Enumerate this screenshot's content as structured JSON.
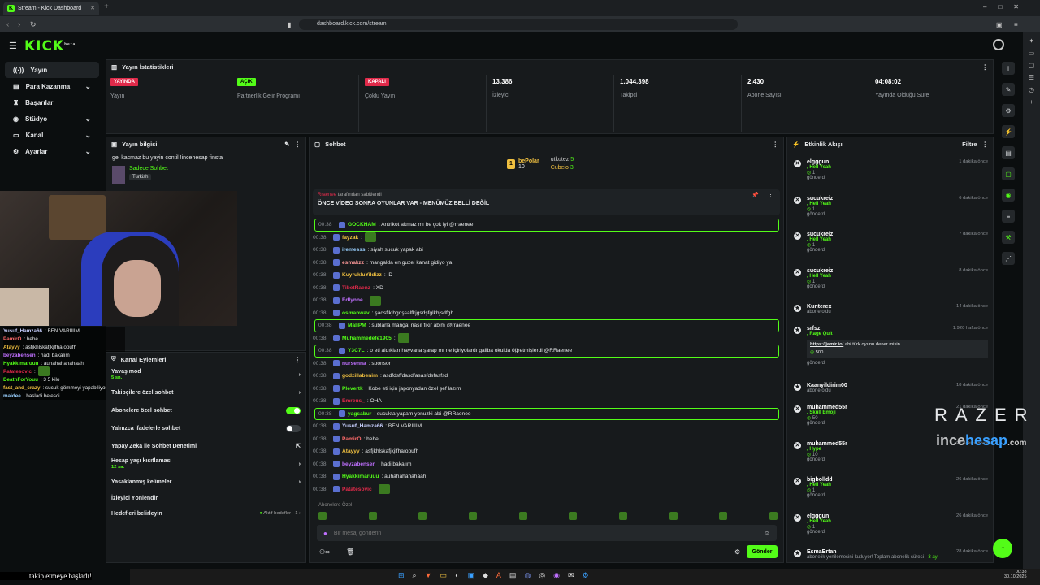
{
  "browser": {
    "tab_title": "Stream - Kick Dashboard",
    "new_tab": "+",
    "url": "dashboard.kick.com/stream",
    "window_controls": [
      "–",
      "□",
      "✕"
    ]
  },
  "topnav": {
    "logo": "KICK",
    "logo_badge": "beta"
  },
  "leftnav": {
    "items": [
      {
        "label": "Yayın",
        "active": true,
        "icon": "broadcast-icon"
      },
      {
        "label": "Para Kazanma",
        "chevron": true,
        "icon": "money-icon"
      },
      {
        "label": "Başarılar",
        "icon": "trophy-icon"
      },
      {
        "label": "Stüdyo",
        "chevron": true,
        "icon": "studio-icon"
      },
      {
        "label": "Kanal",
        "chevron": true,
        "icon": "channel-icon"
      },
      {
        "label": "Ayarlar",
        "chevron": true,
        "icon": "gear-icon"
      }
    ]
  },
  "stats": {
    "title": "Yayın İstatistikleri",
    "items": [
      {
        "badge": "YAYINDA",
        "badge_color": "#e02a4a",
        "label": "Yayın"
      },
      {
        "badge": "AÇIK",
        "badge_color": "#53fc18",
        "label": "Partnerlik Gelir Programı"
      },
      {
        "badge": "KAPALI",
        "badge_color": "#e02a4a",
        "label": "Çoklu Yayın"
      },
      {
        "value": "13.386",
        "label": "İzleyici"
      },
      {
        "value": "1.044.398",
        "label": "Takipçi"
      },
      {
        "value": "2.430",
        "label": "Abone Sayısı"
      },
      {
        "value": "04:08:02",
        "label": "Yayında Olduğu Süre"
      }
    ]
  },
  "stream_info": {
    "title": "Yayın bilgisi",
    "stream_title": "gel kacmaz bu yayin contil !incehesap finsta",
    "category": "Sadece Sohbet",
    "tag": "Turkish"
  },
  "overlay_chat": [
    {
      "user": "Yusuf_Hamza66",
      "msg": ": BEN VARIIIIM",
      "color": "#c8d0ff"
    },
    {
      "user": "PamirO",
      "msg": ": hehe",
      "color": "#ff6b6b"
    },
    {
      "user": "Atayyy",
      "msg": ": asfjkhlskafjkjlfhaıopufh",
      "color": "#f0c040"
    },
    {
      "user": "beyzabensen",
      "msg": ": hadi bakalım",
      "color": "#c070ff"
    },
    {
      "user": "Hyakkimaruuu",
      "msg": ": auhahahahahaah",
      "color": "#53fc18"
    },
    {
      "user": "Patatesovic",
      "msg": ":",
      "color": "#e02a4a"
    },
    {
      "user": "DeathForYouu",
      "msg": ": 3 5 kilo",
      "color": "#53fc18"
    },
    {
      "user": "fast_and_crazy",
      "msg": ": sucuk gömmeyi yapabiliyormu abi peki :)",
      "color": "#f0c040"
    },
    {
      "user": "maidee",
      "msg": ": basladi belesci",
      "color": "#9ad0ff"
    }
  ],
  "channel_actions": {
    "title": "Kanal Eylemleri",
    "items": [
      {
        "label": "Yavaş mod",
        "sub": "5 sn.",
        "control": "chevron"
      },
      {
        "label": "Takipçilere özel sohbet",
        "sub": "",
        "control": "chevron"
      },
      {
        "label": "Abonelere özel sohbet",
        "sub": "",
        "control": "toggle-on"
      },
      {
        "label": "Yalnızca ifadelerle sohbet",
        "sub": "",
        "control": "toggle-off"
      },
      {
        "label": "Yapay Zeka ile Sohbet Denetimi",
        "sub": "",
        "control": "external"
      },
      {
        "label": "Hesap yaşı kısıtlaması",
        "sub": "12 sa.",
        "control": "chevron"
      },
      {
        "label": "Yasaklanmış kelimeler",
        "sub": "",
        "control": "chevron"
      },
      {
        "label": "İzleyici Yönlendir",
        "sub": "",
        "control": "none"
      },
      {
        "label": "Hedefleri belirleyin",
        "sub": "",
        "control": "goal",
        "extra": "Aktif hedefler - 1"
      }
    ]
  },
  "chat": {
    "title": "Sohbet",
    "leaderboard": [
      {
        "rank": "1",
        "name": "bePolar",
        "count": "10"
      },
      {
        "name": "utkutez",
        "count": "5"
      },
      {
        "name": "Cubeio",
        "count": "3"
      }
    ],
    "pinned": {
      "by": "tarafından sabitlendi",
      "user": "Rraenee",
      "text": "ÖNCE VİDEO SONRA OYUNLAR VAR - MENÜMÜZ BELLİ DEĞİL"
    },
    "messages": [
      {
        "time": "00:38",
        "user": "GOCKHAM",
        "color": "#53fc18",
        "text": ": Antrikot akmaz mı be çok iyi @rraenee",
        "hl": true
      },
      {
        "time": "00:38",
        "user": "fayzak",
        "color": "#f0c040",
        "text": ":",
        "emote": true
      },
      {
        "time": "00:38",
        "user": "iremesss",
        "color": "#9ad0ff",
        "text": ": siyah sucuk yapak abi"
      },
      {
        "time": "00:38",
        "user": "esmakzz",
        "color": "#ff9a9a",
        "text": ": mangalda en guzel kanat gidiyo ya"
      },
      {
        "time": "00:38",
        "user": "KuyrukluYildizz",
        "color": "#f0c040",
        "text": ": :D"
      },
      {
        "time": "00:38",
        "user": "TibetRaenz",
        "color": "#e02a4a",
        "text": ": XD"
      },
      {
        "time": "00:38",
        "user": "Edlynne",
        "color": "#c070ff",
        "text": ":",
        "emote": true
      },
      {
        "time": "00:38",
        "user": "osmanwav",
        "color": "#53fc18",
        "text": ": şadsflkjhgdşsalfkjgsdşfglkhjsdfgh"
      },
      {
        "time": "00:38",
        "user": "MaliPM",
        "color": "#53fc18",
        "text": ": sublarla mangal nasıl fikir abim @rraenee",
        "hl": true
      },
      {
        "time": "00:38",
        "user": "Muhammedefe1905",
        "color": "#53fc18",
        "text": ":",
        "emote": true
      },
      {
        "time": "00:38",
        "user": "Y3C7L",
        "color": "#53fc18",
        "text": ": o eti aldıkları hayvana şarap mı ne içiriyolardı galiba okulda öğretmişlerdi @RRaenee",
        "hl": true
      },
      {
        "time": "00:38",
        "user": "nursenna",
        "color": "#c070ff",
        "text": ": sponsor"
      },
      {
        "time": "00:38",
        "user": "godzillabenim",
        "color": "#f0c040",
        "text": ": asdfdsffdasdfasasfdsfasfsd"
      },
      {
        "time": "00:38",
        "user": "Plevertk",
        "color": "#53fc18",
        "text": ": Kobe eti için japonyadan özel şef lazım"
      },
      {
        "time": "00:38",
        "user": "Emreus_",
        "color": "#e02a4a",
        "text": ": OHA"
      },
      {
        "time": "00:38",
        "user": "yagsabur",
        "color": "#53fc18",
        "text": ": sucukta yapamıyonuzki abi @RRaenee",
        "hl": true
      },
      {
        "time": "00:38",
        "user": "Yusuf_Hamza66",
        "color": "#c8d0ff",
        "text": ": BEN VARIIIIM"
      },
      {
        "time": "00:38",
        "user": "PamirO",
        "color": "#ff6b6b",
        "text": ": hehe"
      },
      {
        "time": "00:38",
        "user": "Atayyy",
        "color": "#f0c040",
        "text": ": asfjkhlskafjkjlfhaıopufh"
      },
      {
        "time": "00:38",
        "user": "beyzabensen",
        "color": "#c070ff",
        "text": ": hadi bakalım"
      },
      {
        "time": "00:38",
        "user": "Hyakkimaruuu",
        "color": "#53fc18",
        "text": ": auhahahahahaah"
      },
      {
        "time": "00:38",
        "user": "Patatesovic",
        "color": "#e02a4a",
        "text": ":",
        "emote": true
      }
    ],
    "sub_emotes_label": "Abonelere Özel",
    "input_placeholder": "Bir mesaj gönderin",
    "send_label": "Gönder"
  },
  "activity": {
    "title": "Etkinlik Akışı",
    "filter_label": "Filtre",
    "events": [
      {
        "user": "elgggun",
        "sub": "Hell Yeah",
        "amt": "1",
        "action": "gönderdi",
        "time": "1 dakika önce",
        "icon": "gift"
      },
      {
        "user": "sucukreiz",
        "sub": "Hell Yeah",
        "amt": "1",
        "action": "gönderdi",
        "time": "6 dakika önce",
        "icon": "gift"
      },
      {
        "user": "sucukreiz",
        "sub": "Hell Yeah",
        "amt": "1",
        "action": "gönderdi",
        "time": "7 dakika önce",
        "icon": "gift"
      },
      {
        "user": "sucukreiz",
        "sub": "Hell Yeah",
        "amt": "1",
        "action": "gönderdi",
        "time": "8 dakika önce",
        "icon": "gift"
      },
      {
        "user": "Kunterex",
        "sub": "",
        "amt": "",
        "action": "abone oldu",
        "time": "14 dakika önce",
        "icon": "star"
      },
      {
        "user": "srfsz",
        "sub": "Rage Quit",
        "amt": "500",
        "action": "gönderdi",
        "time": "1.920 hafta önce",
        "icon": "star",
        "link": "https://jamir.io/",
        "linktext": "abi türk oyunu dener misin"
      },
      {
        "user": "Kaanyildirim00",
        "sub": "",
        "amt": "",
        "action": "abone oldu",
        "time": "18 dakika önce",
        "icon": "star"
      },
      {
        "user": "muhammed55r",
        "sub": "Skull Emoji",
        "amt": "50",
        "action": "gönderdi",
        "time": "21 dakika önce",
        "icon": "gift"
      },
      {
        "user": "muhammed55r",
        "sub": "Hype",
        "amt": "10",
        "action": "gönderdi",
        "time": "22 dakika önce",
        "icon": "gift"
      },
      {
        "user": "bigbolldd",
        "sub": "Hell Yeah",
        "amt": "1",
        "action": "gönderdi",
        "time": "26 dakika önce",
        "icon": "gift"
      },
      {
        "user": "elgggun",
        "sub": "Hell Yeah",
        "amt": "1",
        "action": "gönderdi",
        "time": "26 dakika önce",
        "icon": "gift"
      },
      {
        "user": "EsmaErtan",
        "sub": "",
        "amt": "",
        "action": "abonelik yenilemesini kutluyor! Toplam abonelik süresi -",
        "extra": "3 ay!",
        "time": "28 dakika önce",
        "icon": "star"
      }
    ]
  },
  "watermark": {
    "brand": "RAZER",
    "site_a": "ince",
    "site_b": "hesap",
    "site_c": ".com"
  },
  "ticker": "takip etmeye başladı!",
  "clock": {
    "time": "00:38",
    "date": "30.10.2025"
  }
}
